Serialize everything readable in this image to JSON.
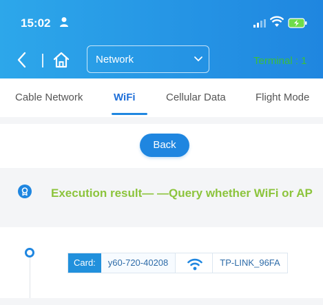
{
  "status_bar": {
    "time": "15:02"
  },
  "nav": {
    "selected_section": "Network",
    "terminal_label": "Terminal : 1"
  },
  "tabs": [
    {
      "label": "Cable Network",
      "active": false
    },
    {
      "label": "WiFi",
      "active": true
    },
    {
      "label": "Cellular Data",
      "active": false
    },
    {
      "label": "Flight Mode",
      "active": false
    }
  ],
  "back_button_label": "Back",
  "result": {
    "title": "Execution result— —Query whether WiFi or AP"
  },
  "timeline": {
    "card_label": "Card:",
    "card_value": "y60-720-40208",
    "ssid": "TP-LINK_96FA"
  },
  "colors": {
    "header_blue": "#1f86e0",
    "accent_green": "#8cc43c",
    "terminal_green": "#3bbf3b"
  },
  "icons": [
    "person-icon",
    "signal-icon",
    "wifi-status-icon",
    "battery-icon",
    "back-icon",
    "home-icon",
    "chevron-down-icon",
    "result-icon",
    "wifi-icon"
  ]
}
